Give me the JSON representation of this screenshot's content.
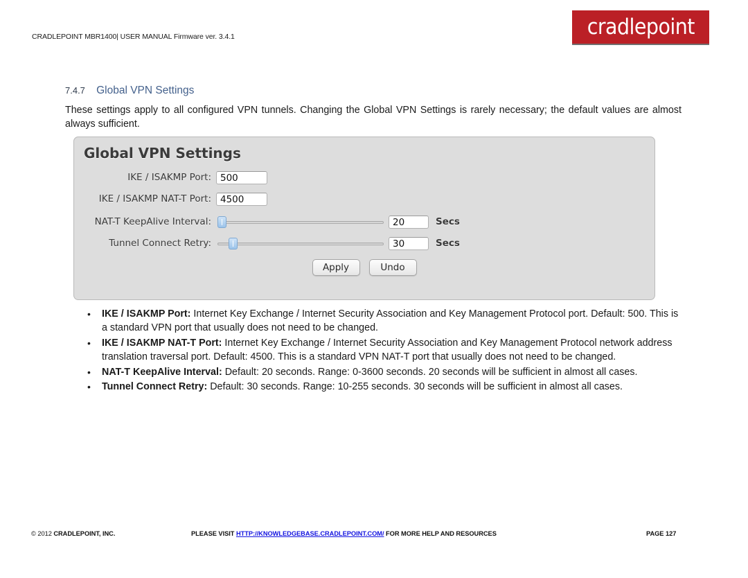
{
  "header": {
    "doc_title": "CRADLEPOINT MBR1400| USER MANUAL Firmware ver. 3.4.1",
    "logo_text": "cradlepoint",
    "logo_color": "#bb2026"
  },
  "section": {
    "number": "7.4.7",
    "title": "Global VPN Settings",
    "title_color": "#44618c",
    "intro": "These settings apply to all configured VPN tunnels. Changing the Global VPN Settings is rarely necessary; the default values are almost always sufficient."
  },
  "panel": {
    "title": "Global VPN Settings",
    "fields": [
      {
        "label": "IKE / ISAKMP Port:",
        "value": "500"
      },
      {
        "label": "IKE / ISAKMP NAT-T Port:",
        "value": "4500"
      },
      {
        "label": "NAT-T KeepAlive Interval:",
        "value": "20",
        "unit": "Secs"
      },
      {
        "label": "Tunnel Connect Retry:",
        "value": "30",
        "unit": "Secs"
      }
    ],
    "buttons": {
      "apply": "Apply",
      "undo": "Undo"
    }
  },
  "bullets": [
    {
      "marker": "•",
      "term": "IKE / ISAKMP Port:",
      "text": " Internet Key Exchange / Internet Security Association and Key Management Protocol port. Default: 500. This is a standard VPN port that usually does not need to be changed."
    },
    {
      "marker": "•",
      "term": "IKE / ISAKMP NAT-T Port:",
      "text": " Internet Key Exchange / Internet Security Association and Key Management Protocol network address translation traversal port. Default: 4500. This is a standard VPN NAT-T port that usually does not need to be changed."
    },
    {
      "marker": "•",
      "term": "NAT-T KeepAlive Interval:",
      "text": " Default: 20 seconds. Range: 0-3600 seconds. 20 seconds will be sufficient in almost all cases."
    },
    {
      "marker": "•",
      "term": "Tunnel Connect Retry:",
      "text": " Default: 30 seconds. Range: 10-255 seconds. 30 seconds will be sufficient in almost all cases."
    }
  ],
  "footer": {
    "copyright_year": "© 2012 ",
    "copyright_company": "CRADLEPOINT, INC.",
    "center_prefix": "PLEASE VISIT ",
    "link": "HTTP://KNOWLEDGEBASE.CRADLEPOINT.COM/",
    "center_suffix": " FOR MORE HELP AND RESOURCES",
    "page": "PAGE 127"
  }
}
